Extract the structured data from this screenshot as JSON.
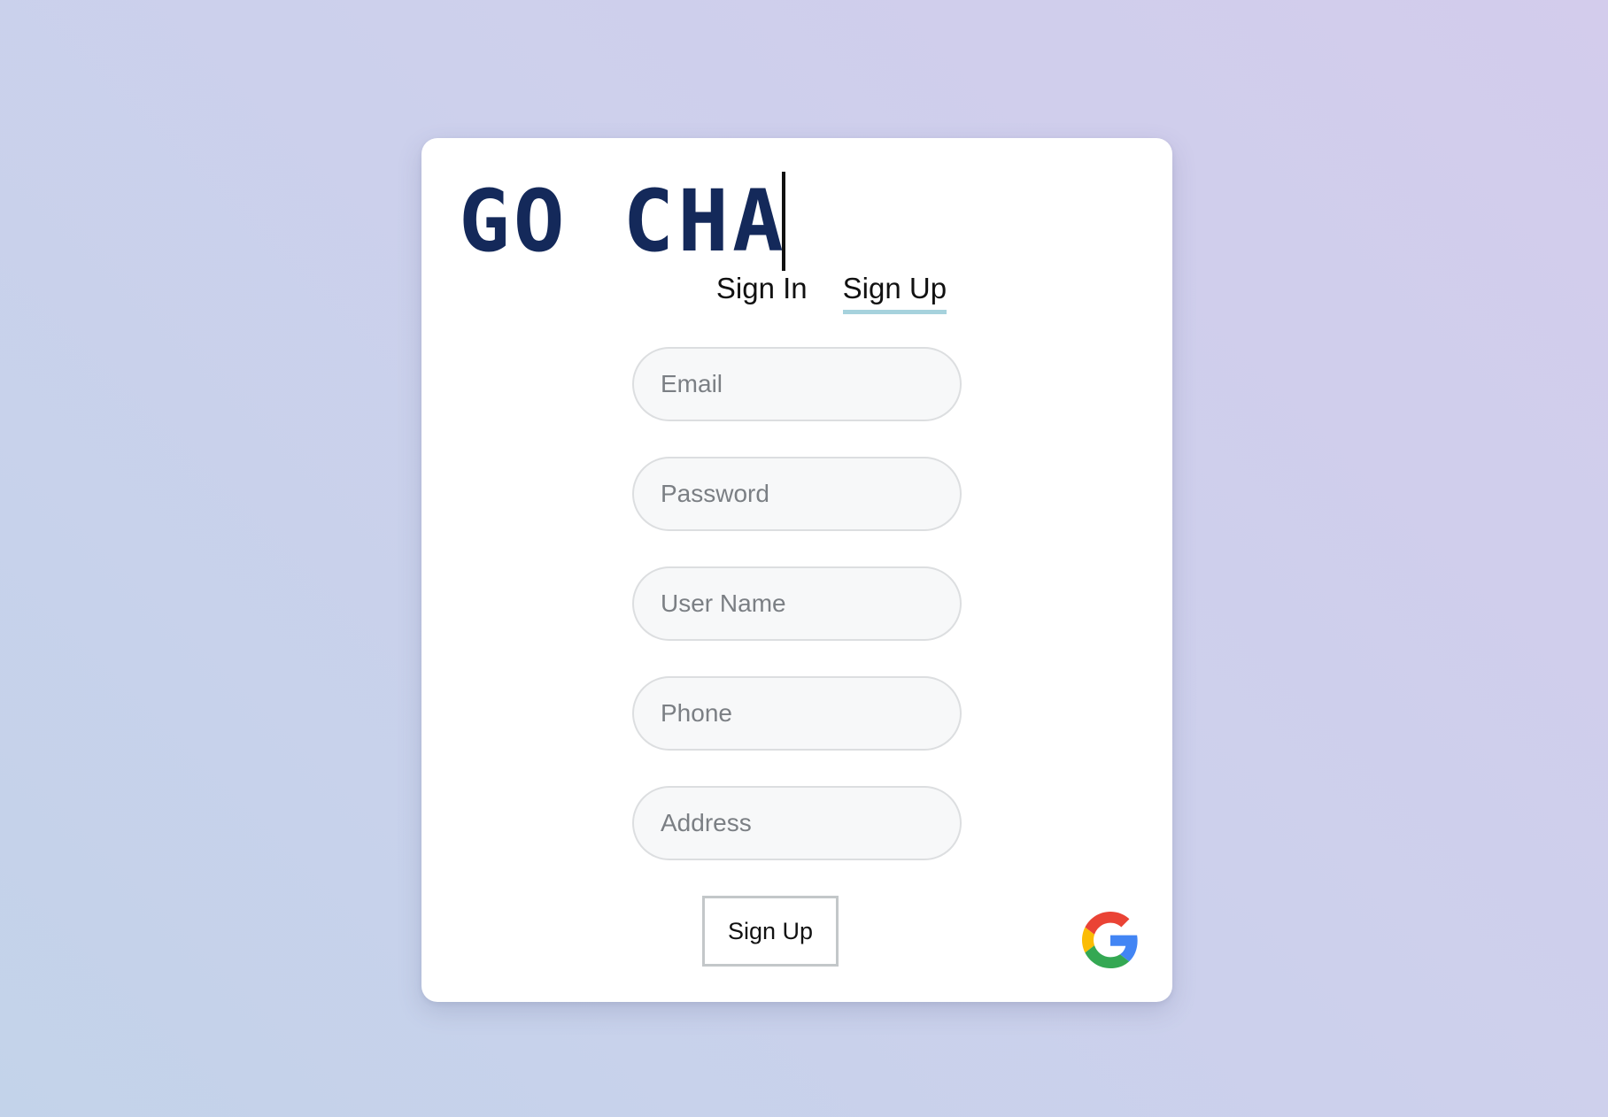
{
  "logo": {
    "text": "GO CHA"
  },
  "tabs": [
    {
      "label": "Sign In",
      "active": false
    },
    {
      "label": "Sign Up",
      "active": true
    }
  ],
  "form": {
    "email_placeholder": "Email",
    "password_placeholder": "Password",
    "username_placeholder": "User Name",
    "phone_placeholder": "Phone",
    "address_placeholder": "Address",
    "submit_label": "Sign Up"
  },
  "social": {
    "google_icon": "google-g-icon"
  },
  "colors": {
    "logo_text": "#14295a",
    "active_tab_underline": "#a6d2dd",
    "field_background": "#f7f8f9",
    "google_red": "#ea4335",
    "google_yellow": "#fbbc05",
    "google_green": "#34a853",
    "google_blue": "#4285f4"
  }
}
